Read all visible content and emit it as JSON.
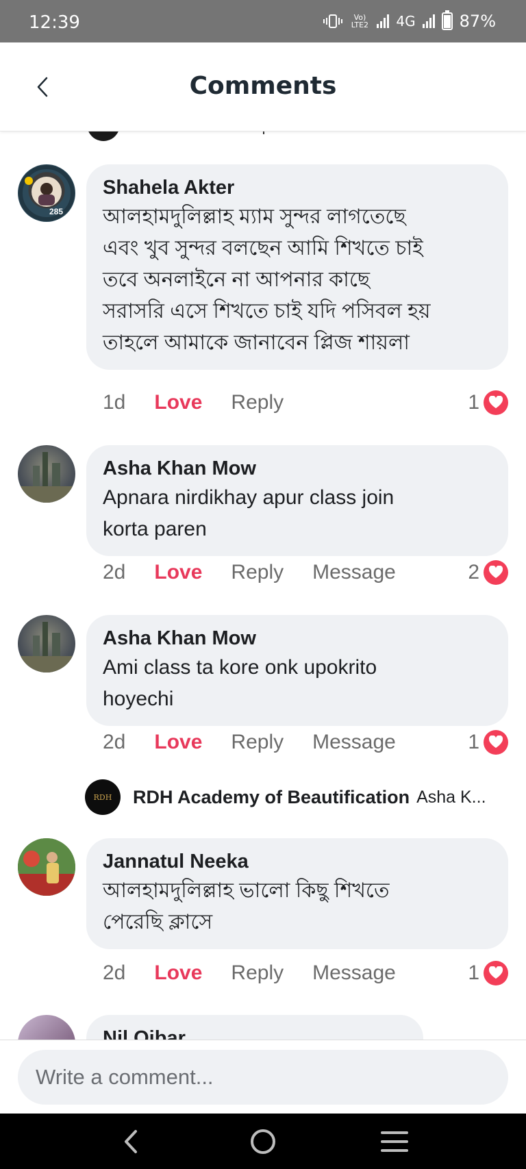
{
  "status_bar": {
    "time": "12:39",
    "volte": "Vo) LTE2",
    "network": "4G",
    "battery": "87%"
  },
  "header": {
    "title": "Comments"
  },
  "comments": [
    {
      "author": "Shahela Akter",
      "badge": "285",
      "lines": [
        "আলহামদুলিল্লাহ ম্যাম সুন্দর লাগতেছে",
        "এবং খুব সুন্দর বলছেন আমি শিখতে চাই",
        "তবে অনলাইনে না  আপনার কাছে",
        "সরাসরি এসে শিখতে চাই  যদি পসিবল হয়",
        "তাহলে  আমাকে জানাবেন প্লিজ শায়লা"
      ],
      "time": "1d",
      "love": "Love",
      "reply": "Reply",
      "reactions": "1"
    },
    {
      "author": "Asha Khan Mow",
      "lines": [
        "Apnara nirdikhay apur class join",
        "korta paren"
      ],
      "time": "2d",
      "love": "Love",
      "reply": "Reply",
      "message": "Message",
      "reactions": "2"
    },
    {
      "author": "Asha Khan Mow",
      "lines": [
        "Ami class ta kore onk upokrito",
        "hoyechi"
      ],
      "time": "2d",
      "love": "Love",
      "reply": "Reply",
      "message": "Message",
      "reactions": "1"
    },
    {
      "author": "Jannatul Neeka",
      "lines": [
        "আলহামদুলিল্লাহ ভালো কিছু শিখতে",
        "পেরেছি ক্লাসে"
      ],
      "time": "2d",
      "love": "Love",
      "reply": "Reply",
      "message": "Message",
      "reactions": "1"
    },
    {
      "author": "Nil Oibar"
    }
  ],
  "reply_preview": {
    "name": "RDH Academy of Beautification",
    "snippet": "Asha K...",
    "logo_text": "RDH"
  },
  "composer": {
    "placeholder": "Write a comment..."
  },
  "colors": {
    "accent_love": "#e8395b",
    "heart": "#f33e58",
    "bubble": "#eff1f4",
    "status_bar": "#757575"
  },
  "icons": [
    "back-chevron-icon",
    "vibrate-icon",
    "signal-icon",
    "battery-icon",
    "heart-reaction-icon",
    "nav-back-icon",
    "nav-home-icon",
    "nav-menu-icon"
  ]
}
